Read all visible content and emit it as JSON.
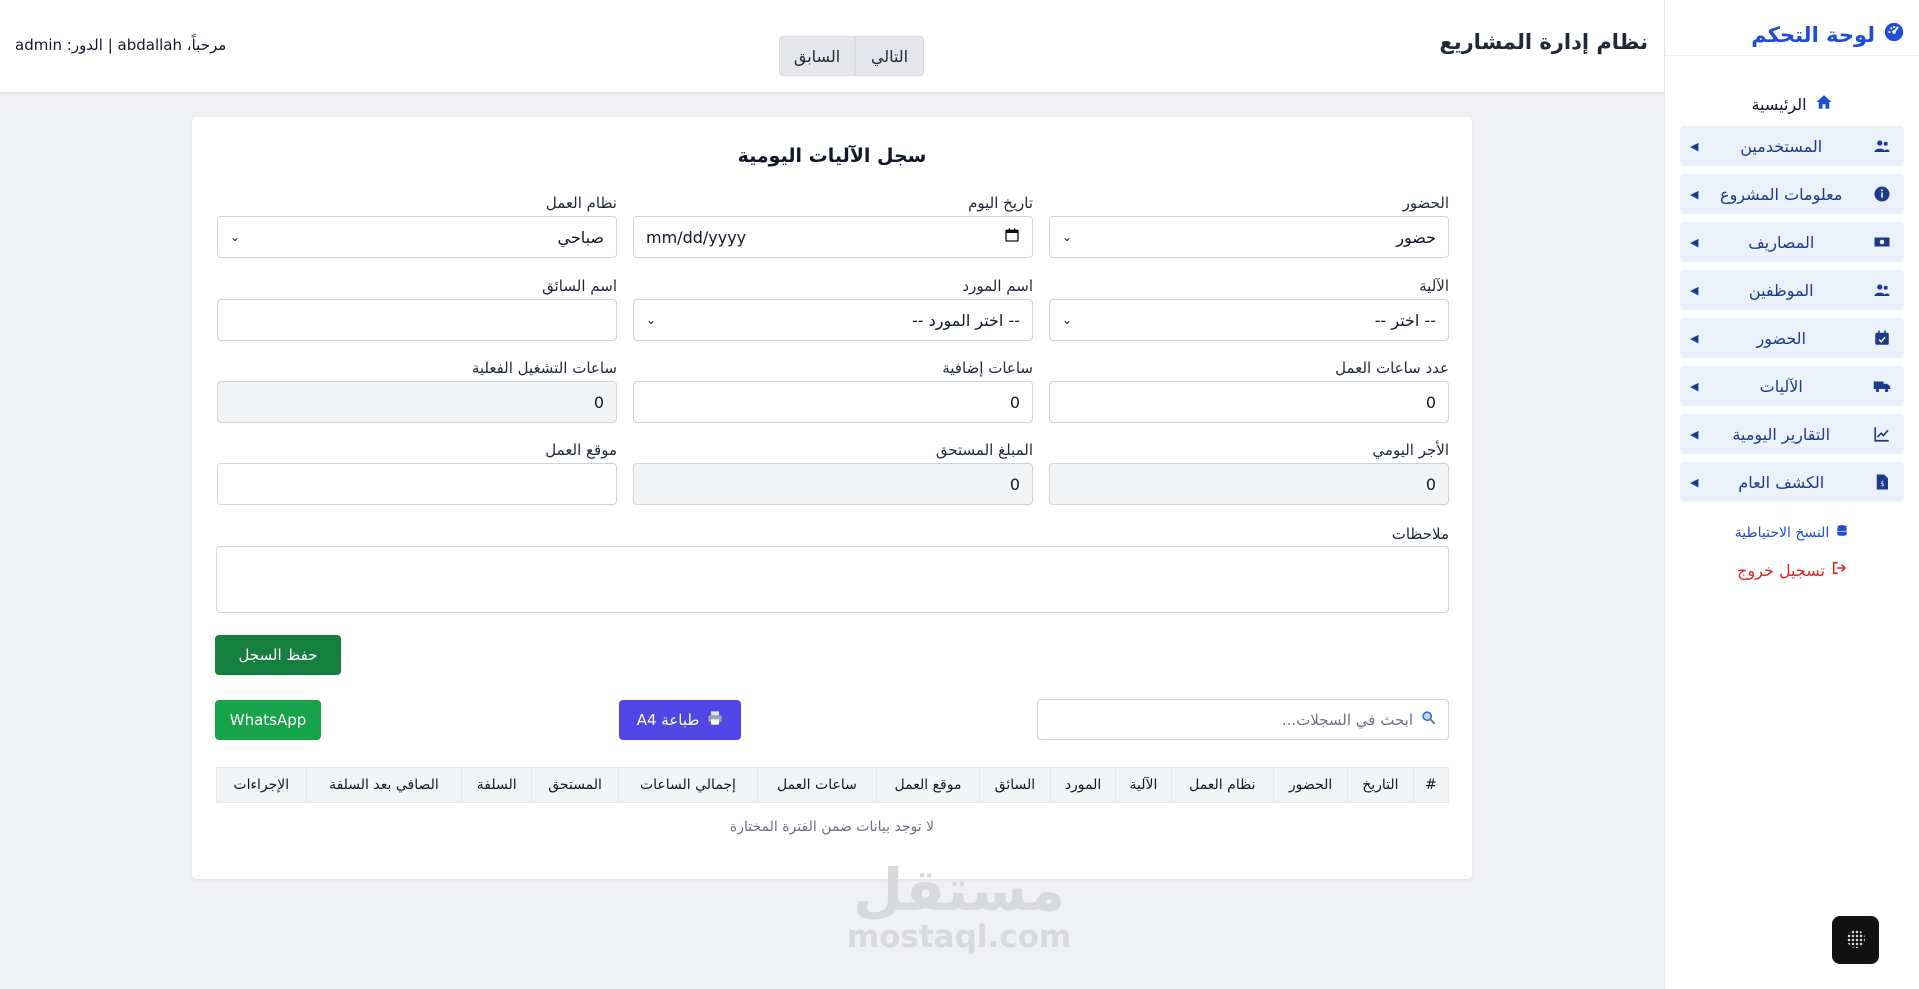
{
  "sidebar": {
    "brand": "لوحة التحكم",
    "home": "الرئيسية",
    "items": [
      {
        "label": "المستخدمين",
        "icon": "users-icon"
      },
      {
        "label": "معلومات المشروع",
        "icon": "info-icon"
      },
      {
        "label": "المصاريف",
        "icon": "money-icon"
      },
      {
        "label": "الموظفين",
        "icon": "users-icon"
      },
      {
        "label": "الحضور",
        "icon": "calendar-check-icon"
      },
      {
        "label": "الآليات",
        "icon": "truck-icon"
      },
      {
        "label": "التقارير اليومية",
        "icon": "chart-line-icon"
      },
      {
        "label": "الكشف العام",
        "icon": "file-invoice-icon"
      }
    ],
    "backup": "النسخ الاحتياطية",
    "logout": "تسجيل خروج"
  },
  "header": {
    "title": "نظام إدارة المشاريع",
    "next": "التالي",
    "prev": "السابق",
    "welcome": "مرحباً، abdallah | الدور: admin"
  },
  "form": {
    "title": "سجل الآليات اليومية",
    "attendance_label": "الحضور",
    "attendance_value": "حضور",
    "date_label": "تاريخ اليوم",
    "date_placeholder": "mm/dd/yyyy",
    "shift_label": "نظام العمل",
    "shift_value": "صباحي",
    "machine_label": "الآلية",
    "machine_value": "-- اختر --",
    "supplier_label": "اسم المورد",
    "supplier_value": "-- اختر المورد --",
    "driver_label": "اسم السائق",
    "work_hours_label": "عدد ساعات العمل",
    "work_hours_value": "0",
    "extra_hours_label": "ساعات إضافية",
    "extra_hours_value": "0",
    "actual_hours_label": "ساعات التشغيل الفعلية",
    "actual_hours_value": "0",
    "daily_wage_label": "الأجر اليومي",
    "daily_wage_value": "0",
    "due_amount_label": "المبلغ المستحق",
    "due_amount_value": "0",
    "location_label": "موقع العمل",
    "notes_label": "ملاحظات",
    "save": "حفظ السجل"
  },
  "actions": {
    "search_placeholder": "ابحث في السجلات...",
    "print": "طباعة A4",
    "whatsapp": "WhatsApp"
  },
  "table": {
    "headers": [
      "#",
      "التاريخ",
      "الحضور",
      "نظام العمل",
      "الآلية",
      "المورد",
      "السائق",
      "موقع العمل",
      "ساعات العمل",
      "إجمالي الساعات",
      "المستحق",
      "السلفة",
      "الصافي بعد السلفة",
      "الإجراءات"
    ],
    "empty": "لا توجد بيانات ضمن الفترة المختارة"
  },
  "watermark": {
    "arabic": "مستقل",
    "latin": "mostaql.com"
  },
  "colors": {
    "primary": "#1d4ed8",
    "save": "#15803d",
    "whatsapp": "#16a34a",
    "print": "#4f46e5",
    "logout": "#dc2626"
  }
}
